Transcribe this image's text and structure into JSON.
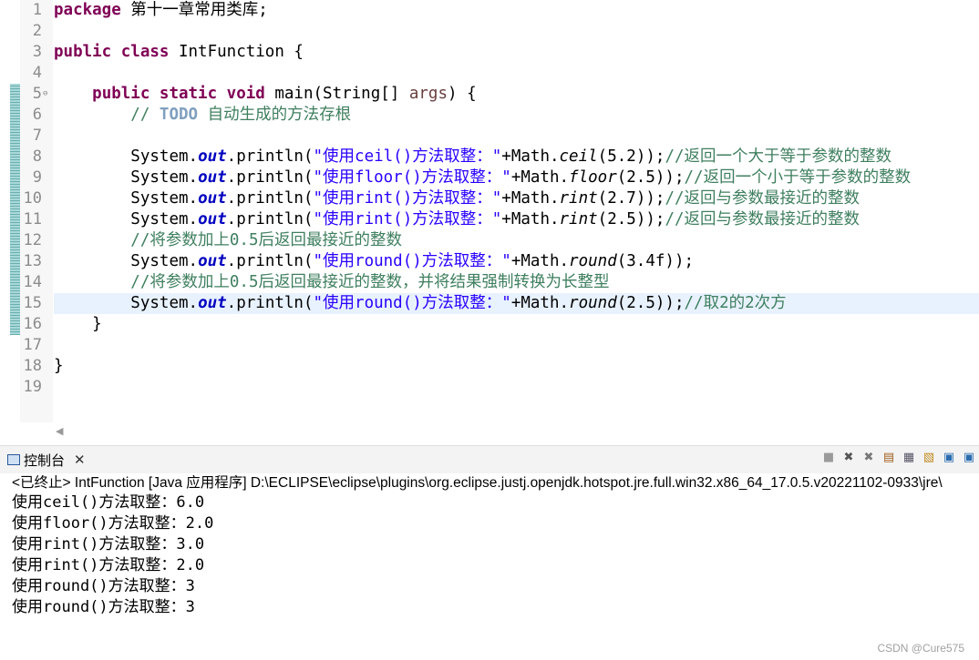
{
  "editor": {
    "line_numbers": [
      "1",
      "2",
      "3",
      "4",
      "5",
      "6",
      "7",
      "8",
      "9",
      "10",
      "11",
      "12",
      "13",
      "14",
      "15",
      "16",
      "17",
      "18",
      "19"
    ],
    "l1_kw": "package",
    "l1_rest": " 第十一章常用类库;",
    "l3_kw": "public class",
    "l3_rest": " IntFunction {",
    "l5_kw": "public static void",
    "l5_main": " main(String[] ",
    "l5_args": "args",
    "l5_end": ") {",
    "l6_cm1": "// ",
    "l6_todo": "TODO",
    "l6_cm2": " 自动生成的方法存根",
    "sys": "System.",
    "out": "out",
    "println": ".println(",
    "l8_str": "\"使用ceil()方法取整：\"",
    "l8_mid": "+Math.",
    "l8_fn": "ceil",
    "l8_args": "(5.2));",
    "l8_cm": "//返回一个大于等于参数的整数",
    "l9_str": "\"使用floor()方法取整：\"",
    "l9_mid": "+Math.",
    "l9_fn": "floor",
    "l9_args": "(2.5));",
    "l9_cm": "//返回一个小于等于参数的整数",
    "l10_str": "\"使用rint()方法取整：\"",
    "l10_mid": "+Math.",
    "l10_fn": "rint",
    "l10_args": "(2.7));",
    "l10_cm": "//返回与参数最接近的整数",
    "l11_str": "\"使用rint()方法取整：\"",
    "l11_mid": "+Math.",
    "l11_fn": "rint",
    "l11_args": "(2.5));",
    "l11_cm": "//返回与参数最接近的整数",
    "l12_cm": "//将参数加上0.5后返回最接近的整数",
    "l13_str": "\"使用round()方法取整：\"",
    "l13_mid": "+Math.",
    "l13_fn": "round",
    "l13_args": "(3.4f));",
    "l14_cm": "//将参数加上0.5后返回最接近的整数，并将结果强制转换为长整型",
    "l15_str": "\"使用round()方法取整：\"",
    "l15_mid": "+Math.",
    "l15_fn": "round",
    "l15_args": "(2.5));",
    "l15_cm": "//取2的2次方",
    "l16": "}",
    "l18": "}"
  },
  "console": {
    "tab_label": "控制台",
    "close": "✕",
    "status": "<已终止> IntFunction [Java 应用程序] D:\\ECLIPSE\\eclipse\\plugins\\org.eclipse.justj.openjdk.hotspot.jre.full.win32.x86_64_17.0.5.v20221102-0933\\jre\\",
    "output": [
      "使用ceil()方法取整：6.0",
      "使用floor()方法取整：2.0",
      "使用rint()方法取整：3.0",
      "使用rint()方法取整：2.0",
      "使用round()方法取整：3",
      "使用round()方法取整：3"
    ],
    "toolbar_icons": [
      "terminate-icon",
      "remove-launch-icon",
      "remove-all-icon",
      "clear-console-icon",
      "scroll-lock-icon",
      "word-wrap-icon",
      "pin-console-icon",
      "display-selected-icon"
    ]
  },
  "watermark": "CSDN @Cure575"
}
